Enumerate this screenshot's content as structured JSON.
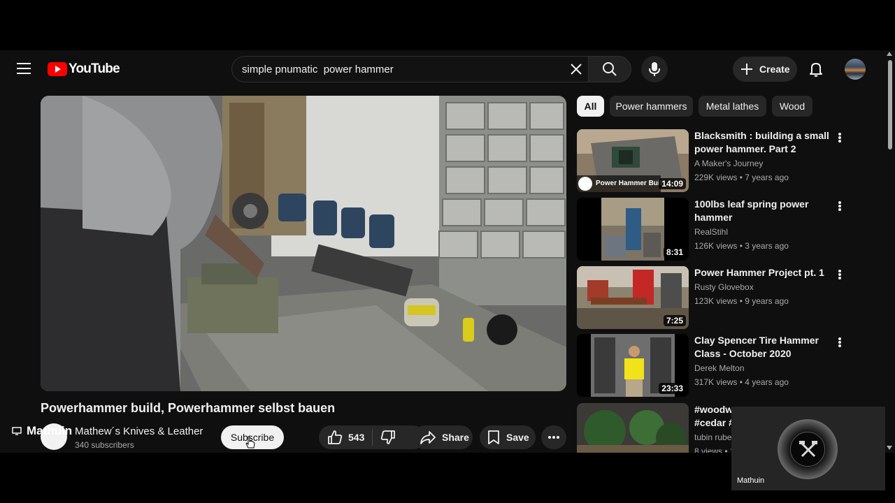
{
  "header": {
    "logo_text": "YouTube",
    "search_value": "simple pnumatic  power hammer",
    "create_label": "Create"
  },
  "video": {
    "title": "Powerhammer build, Powerhammer selbst bauen",
    "overlay_name": "Mathuin",
    "channel_name": "Mathew´s Knives & Leather",
    "subscribers": "340 subscribers",
    "subscribe_label": "Subscribe",
    "likes": "543",
    "share_label": "Share",
    "save_label": "Save"
  },
  "chips": [
    "All",
    "Power hammers",
    "Metal lathes",
    "Wood"
  ],
  "recommendations": [
    {
      "title": "Blacksmith : building a small power hammer. Part 2",
      "channel": "A Maker's Journey",
      "meta": "229K views • 7 years ago",
      "duration": "14:09",
      "thumb_caption": "Power Hammer Buil"
    },
    {
      "title": "100lbs leaf spring power hammer",
      "channel": "RealStihl",
      "meta": "126K views • 3 years ago",
      "duration": "8:31"
    },
    {
      "title": "Power Hammer Project pt. 1",
      "channel": "Rusty Glovebox",
      "meta": "123K views • 9 years ago",
      "duration": "7:25"
    },
    {
      "title": "Clay Spencer Tire Hammer Class - October 2020",
      "channel": "Derek Melton",
      "meta": "317K views • 4 years ago",
      "duration": "23:33"
    },
    {
      "title": "#woodw",
      "title2": "#cedar #",
      "channel": "tubin ruber",
      "meta": "8 views • 1"
    }
  ],
  "overlay": {
    "name": "Mathuin"
  },
  "colors": {
    "background": "#0f0f0f",
    "logo_red": "#ff0000",
    "chip": "#272727"
  }
}
